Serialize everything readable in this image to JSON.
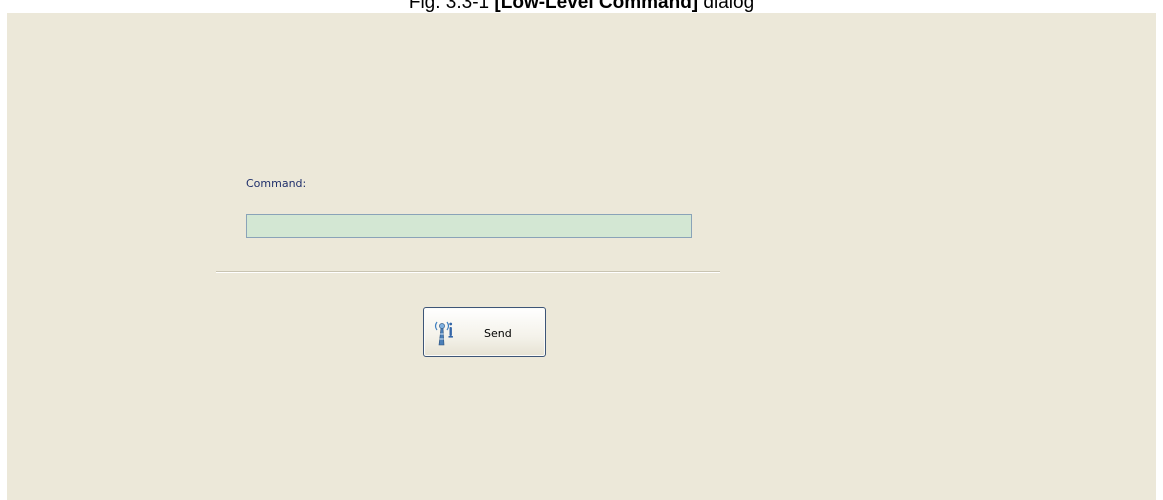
{
  "caption": {
    "prefix": "Fig. 3.3-1 ",
    "bold": "[Low-Level Command]",
    "suffix": " dialog"
  },
  "dialog": {
    "command_label": "Command:",
    "command_value": "",
    "send_label": "Send"
  },
  "colors": {
    "dialog_bg": "#ece8d9",
    "input_bg": "#d3e7d3",
    "label_text": "#1f2f6b"
  },
  "icons": {
    "send": "antenna-signal-icon"
  }
}
